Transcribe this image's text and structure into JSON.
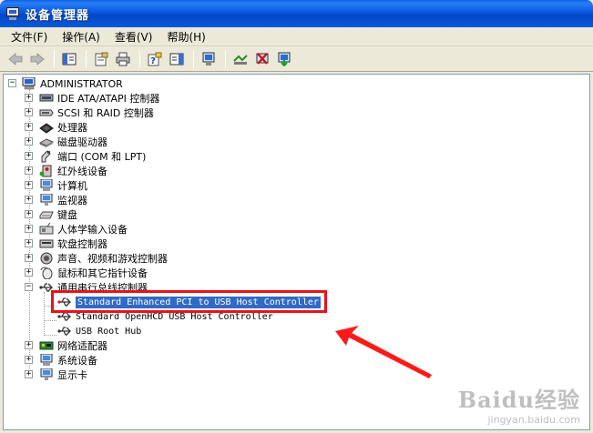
{
  "window": {
    "title": "设备管理器"
  },
  "menu": [
    {
      "label": "文件(F)"
    },
    {
      "label": "操作(A)"
    },
    {
      "label": "查看(V)"
    },
    {
      "label": "帮助(H)"
    }
  ],
  "tree": {
    "root": "ADMINISTRATOR",
    "categories": [
      {
        "label": "IDE ATA/ATAPI 控制器",
        "icon": "ide-controller-icon"
      },
      {
        "label": "SCSI 和 RAID 控制器",
        "icon": "scsi-controller-icon"
      },
      {
        "label": "处理器",
        "icon": "processor-icon"
      },
      {
        "label": "磁盘驱动器",
        "icon": "disk-drive-icon"
      },
      {
        "label": "端口 (COM 和 LPT)",
        "icon": "port-icon"
      },
      {
        "label": "红外线设备",
        "icon": "infrared-icon"
      },
      {
        "label": "计算机",
        "icon": "computer-icon"
      },
      {
        "label": "监视器",
        "icon": "monitor-icon"
      },
      {
        "label": "键盘",
        "icon": "keyboard-icon"
      },
      {
        "label": "人体学输入设备",
        "icon": "hid-icon"
      },
      {
        "label": "软盘控制器",
        "icon": "floppy-controller-icon"
      },
      {
        "label": "声音、视频和游戏控制器",
        "icon": "sound-icon"
      },
      {
        "label": "鼠标和其它指针设备",
        "icon": "mouse-icon"
      },
      {
        "label": "通用串行总线控制器",
        "icon": "usb-icon"
      }
    ],
    "usb_children": [
      {
        "label": "Standard Enhanced PCI to USB Host Controller",
        "selected": true
      },
      {
        "label": "Standard OpenHCD USB Host Controller",
        "selected": false
      },
      {
        "label": "USB Root Hub",
        "selected": false
      }
    ],
    "categories_after": [
      {
        "label": "网络适配器",
        "icon": "network-adapter-icon"
      },
      {
        "label": "系统设备",
        "icon": "system-device-icon"
      },
      {
        "label": "显示卡",
        "icon": "display-adapter-icon"
      }
    ]
  },
  "watermark": {
    "main": "Baidu经验",
    "sub": "jingyan.baidu.com"
  },
  "colors": {
    "titlebar": "#0a5ad8",
    "selection": "#316ac5",
    "highlight": "#e8121a"
  }
}
